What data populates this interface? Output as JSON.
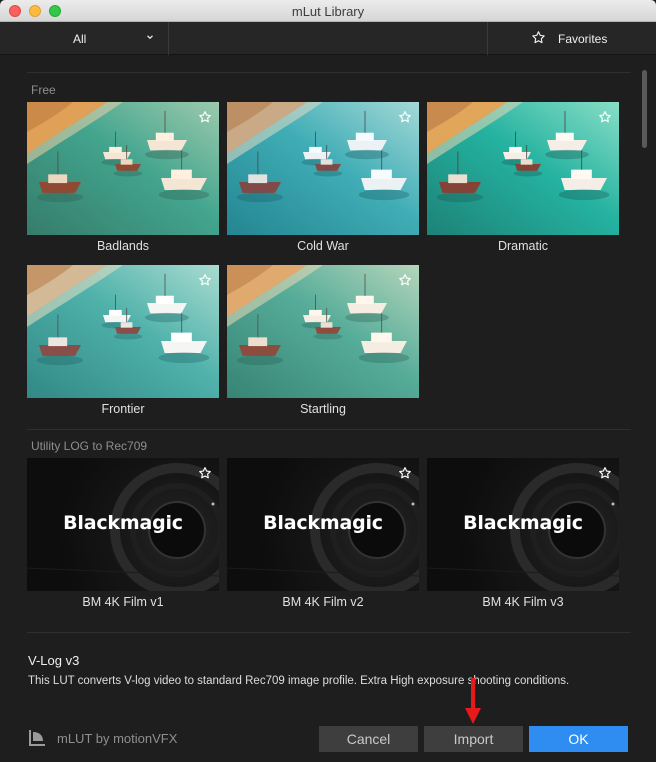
{
  "window": {
    "title": "mLut Library"
  },
  "toolbar": {
    "filter_value": "All",
    "favorites_label": "Favorites"
  },
  "sections": [
    {
      "title": "Free",
      "items": [
        {
          "name": "Badlands",
          "style": "warm"
        },
        {
          "name": "Cold War",
          "style": "cool"
        },
        {
          "name": "Dramatic",
          "style": "vivid"
        },
        {
          "name": "Frontier",
          "style": "faded"
        },
        {
          "name": "Startling",
          "style": "warm2"
        }
      ]
    },
    {
      "title": "Utility LOG to Rec709",
      "items": [
        {
          "name": "BM 4K Film v1",
          "thumb_text": "Blackmagic"
        },
        {
          "name": "BM 4K Film v2",
          "thumb_text": "Blackmagic"
        },
        {
          "name": "BM 4K Film v3",
          "thumb_text": "Blackmagic"
        }
      ]
    }
  ],
  "info": {
    "title": "V-Log v3",
    "description": "This LUT converts V-log video to standard Rec709 image profile. Extra High exposure shooting conditions."
  },
  "footer": {
    "brand": "mLUT by motionVFX",
    "cancel_label": "Cancel",
    "import_label": "Import",
    "ok_label": "OK"
  },
  "colors": {
    "accent": "#2f8df2",
    "annotation_arrow": "#e8191b",
    "background": "#1e1e1e"
  },
  "icons": {
    "filter": "chevron-down-icon",
    "favorites": "star-outline-icon",
    "tile_favorite": "star-outline-icon",
    "brand": "mlut-logo-icon"
  }
}
